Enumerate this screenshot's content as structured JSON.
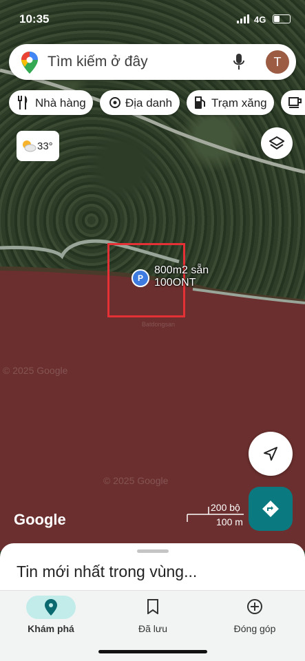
{
  "status_bar": {
    "time": "10:35",
    "network": "4G"
  },
  "search": {
    "placeholder": "Tìm kiếm ở đây",
    "avatar_initial": "T"
  },
  "chips": [
    {
      "label": "Nhà hàng",
      "icon": "restaurant-icon"
    },
    {
      "label": "Địa danh",
      "icon": "landmark-icon"
    },
    {
      "label": "Trạm xăng",
      "icon": "gas-station-icon"
    }
  ],
  "weather": {
    "temp": "33°",
    "icon": "partly-cloudy-icon"
  },
  "marker": {
    "label_line1": "800m2 sẵn",
    "label_line2": "100ONT",
    "icon": "parking-pin-icon"
  },
  "map": {
    "watermarks": [
      "© 2025 Google",
      "© 2025 Google",
      "Batdongsan"
    ],
    "logo": "Google",
    "scale_top": "200 bộ",
    "scale_bottom": "100 m"
  },
  "sheet": {
    "title": "Tin mới nhất trong vùng..."
  },
  "nav": {
    "items": [
      {
        "label": "Khám phá",
        "icon": "explore-pin-icon",
        "active": true
      },
      {
        "label": "Đã lưu",
        "icon": "bookmark-icon",
        "active": false
      },
      {
        "label": "Đóng góp",
        "icon": "add-circle-icon",
        "active": false
      }
    ]
  },
  "colors": {
    "accent": "#0b7a80",
    "marker_box": "#e53035",
    "river": "#6a2f2e",
    "nav_active": "#c2ecea"
  }
}
